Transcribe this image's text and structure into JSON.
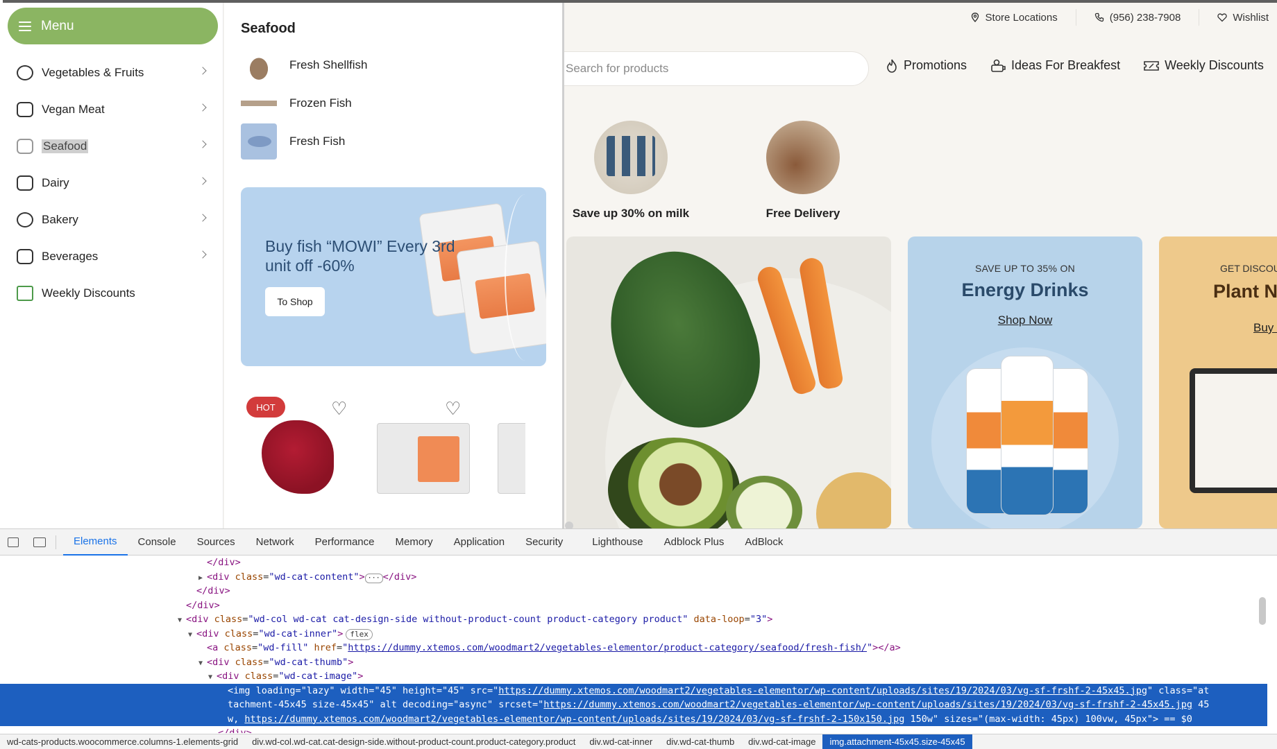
{
  "menu": {
    "button_label": "Menu",
    "categories": [
      {
        "label": "Vegetables & Fruits",
        "icon": "vegetables-icon",
        "has_children": true
      },
      {
        "label": "Vegan Meat",
        "icon": "vegan-meat-icon",
        "has_children": true
      },
      {
        "label": "Seafood",
        "icon": "seafood-icon",
        "has_children": true,
        "active": true
      },
      {
        "label": "Dairy",
        "icon": "dairy-icon",
        "has_children": true
      },
      {
        "label": "Bakery",
        "icon": "bakery-icon",
        "has_children": true
      },
      {
        "label": "Beverages",
        "icon": "beverages-icon",
        "has_children": true
      },
      {
        "label": "Weekly Discounts",
        "icon": "discount-icon",
        "has_children": false
      }
    ]
  },
  "submenu": {
    "title": "Seafood",
    "items": [
      {
        "label": "Fresh Shellfish"
      },
      {
        "label": "Frozen Fish"
      },
      {
        "label": "Fresh Fish"
      }
    ],
    "promo": {
      "text": "Buy fish “MOWI” Every 3rd unit off -60%",
      "button": "To Shop"
    },
    "products": [
      {
        "badge": "HOT"
      }
    ]
  },
  "topbar": {
    "store_locations": "Store Locations",
    "phone": "(956) 238-7908",
    "wishlist": "Wishlist"
  },
  "search": {
    "placeholder": "Search for products"
  },
  "nav": {
    "promotions": "Promotions",
    "breakfast": "Ideas For Breakfest",
    "weekly": "Weekly Discounts"
  },
  "features": {
    "milk": "Save up 30% on milk",
    "delivery": "Free Delivery"
  },
  "banners": {
    "energy": {
      "sub": "SAVE UP TO 35% ON",
      "title": "Energy Drinks",
      "link": "Shop Now"
    },
    "plant": {
      "sub": "GET DISCOU",
      "title": "Plant Nu",
      "link": "Buy N"
    }
  },
  "devtools": {
    "tabs": [
      "Elements",
      "Console",
      "Sources",
      "Network",
      "Performance",
      "Memory",
      "Application",
      "Security",
      "Lighthouse",
      "Adblock Plus",
      "AdBlock"
    ],
    "active_tab": "Elements",
    "breadcrumbs": [
      "wd-cats-products.woocommerce.columns-1.elements-grid",
      "div.wd-col.wd-cat.cat-design-side.without-product-count.product-category.product",
      "div.wd-cat-inner",
      "div.wd-cat-thumb",
      "div.wd-cat-image",
      "img.attachment-45x45.size-45x45"
    ]
  }
}
